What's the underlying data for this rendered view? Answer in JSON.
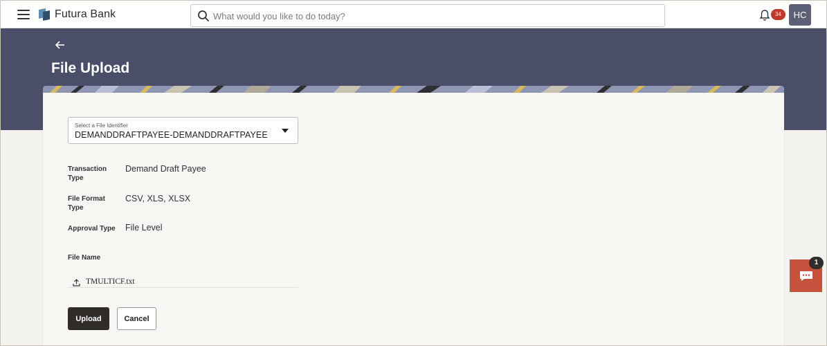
{
  "header": {
    "brand": "Futura Bank",
    "search_placeholder": "What would you like to do today?",
    "notification_count": "34",
    "avatar_initials": "HC"
  },
  "page": {
    "title": "File Upload"
  },
  "form": {
    "file_identifier_label": "Select a File Identifier",
    "file_identifier_value": "DEMANDDRAFTPAYEE-DEMANDDRAFTPAYEE",
    "fields": [
      {
        "label": "Transaction Type",
        "value": "Demand Draft Payee"
      },
      {
        "label": "File Format Type",
        "value": "CSV, XLS, XLSX"
      },
      {
        "label": "Approval Type",
        "value": "File Level"
      },
      {
        "label": "File Name",
        "value": ""
      }
    ],
    "file_name": "TMULTICF.txt",
    "upload_label": "Upload",
    "cancel_label": "Cancel"
  },
  "chat": {
    "badge_count": "1"
  },
  "colors": {
    "header_band": "#4a4e69",
    "primary_button": "#2f2c2a",
    "chat_button": "#c8513e",
    "notification_badge": "#c0392b"
  },
  "icons": [
    "hamburger-menu-icon",
    "bank-logo-icon",
    "search-icon",
    "bell-icon",
    "back-arrow-icon",
    "dropdown-caret-icon",
    "upload-icon",
    "chat-icon"
  ]
}
